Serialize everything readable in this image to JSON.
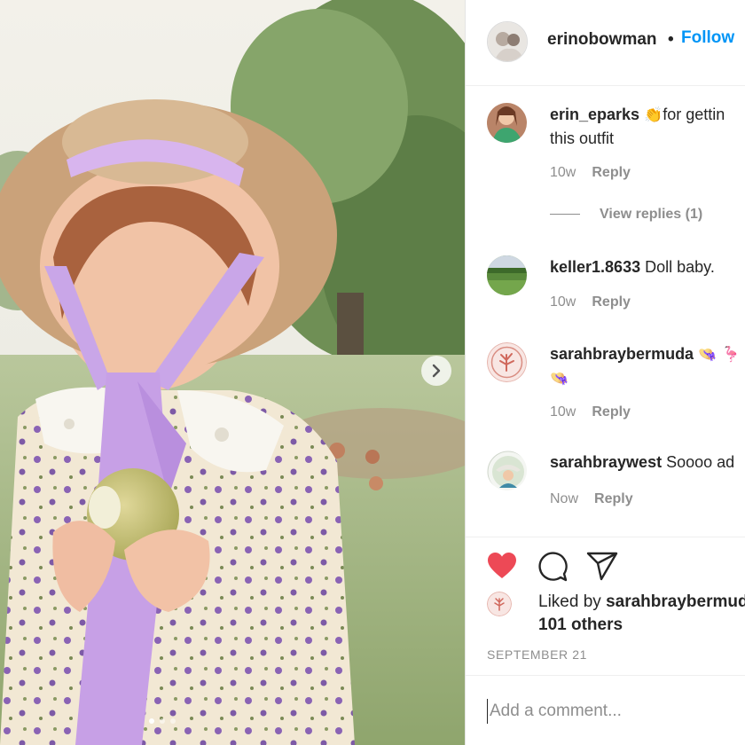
{
  "post": {
    "username": "erinobowman",
    "separator": "•",
    "follow_label": "Follow"
  },
  "comments": [
    {
      "username": "erin_eparks",
      "emoji": "👏",
      "text_line1": "for gettin",
      "text_line2": "this outfit",
      "age": "10w",
      "reply_label": "Reply",
      "view_replies": "View replies (1)"
    },
    {
      "username": "keller1.8633",
      "text_line1": "Doll baby.",
      "age": "10w",
      "reply_label": "Reply"
    },
    {
      "username": "sarahbraybermuda",
      "emoji_line1": "👒 🦩",
      "emoji_line2": "👒",
      "age": "10w",
      "reply_label": "Reply"
    },
    {
      "username": "sarahbraywest",
      "text_line1": "Soooo ad",
      "age": "Now",
      "reply_label": "Reply"
    }
  ],
  "likes": {
    "prefix": "Liked by",
    "user": "sarahbraybermuda",
    "others": "101 others"
  },
  "date": "SEPTEMBER 21",
  "add_comment": {
    "placeholder": "Add a comment..."
  },
  "icons": [
    "heart-icon",
    "comment-icon",
    "share-icon",
    "next-arrow-icon"
  ],
  "colors": {
    "follow": "#0095f6",
    "liked_heart": "#ed4956",
    "muted_text": "#8e8e8e",
    "ribbon": "#c9a6e8"
  },
  "carousel": {
    "slides": 3,
    "active": 1
  }
}
